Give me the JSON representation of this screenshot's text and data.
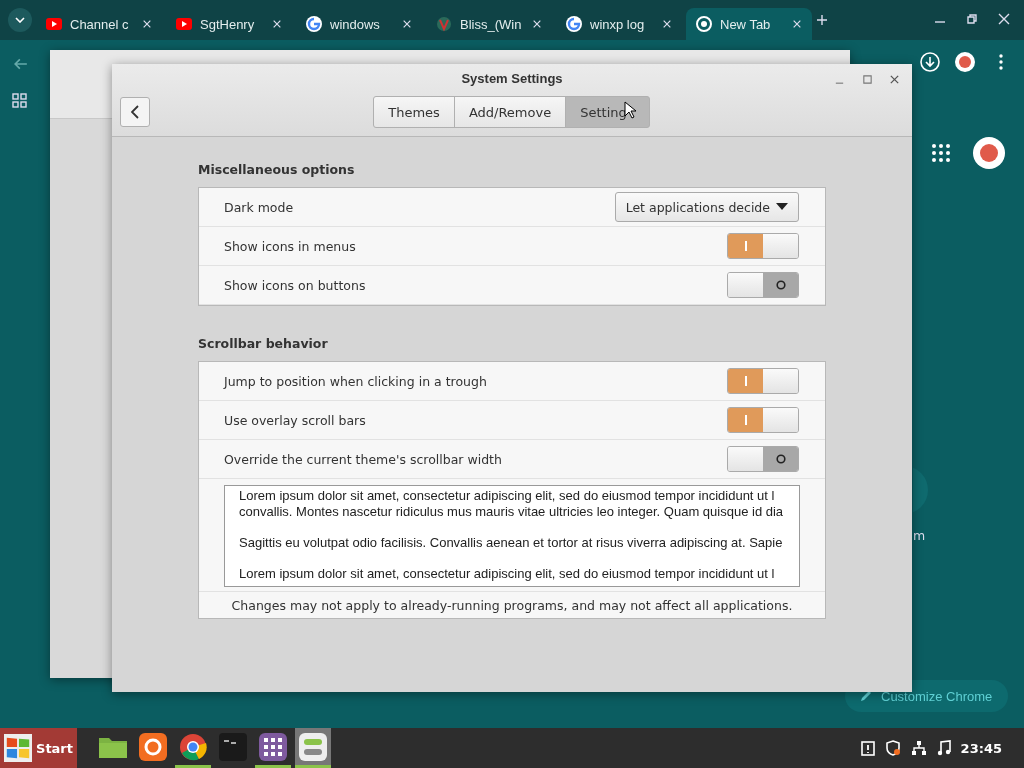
{
  "browser": {
    "tabs": [
      {
        "title": "Channel c",
        "kind": "video",
        "selected": false
      },
      {
        "title": "SgtHenry",
        "kind": "video",
        "selected": false
      },
      {
        "title": "windows",
        "kind": "search",
        "selected": false
      },
      {
        "title": "Bliss_(Win",
        "kind": "wiki",
        "selected": false
      },
      {
        "title": "winxp log",
        "kind": "search",
        "selected": false
      },
      {
        "title": "New Tab",
        "kind": "browser",
        "selected": true
      }
    ],
    "shortcut_label": "m",
    "customize_button": "Customize Chrome"
  },
  "settings_window": {
    "title": "System Settings",
    "tabs": [
      {
        "label": "Themes",
        "selected": false
      },
      {
        "label": "Add/Remove",
        "selected": false
      },
      {
        "label": "Setting",
        "selected": true
      }
    ],
    "sections": [
      {
        "heading": "Miscellaneous options",
        "rows": [
          {
            "kind": "dropdown",
            "label": "Dark mode",
            "value": "Let applications decide"
          },
          {
            "kind": "switch",
            "label": "Show icons in menus",
            "on": true
          },
          {
            "kind": "switch",
            "label": "Show icons on buttons",
            "on": false
          }
        ]
      },
      {
        "heading": "Scrollbar behavior",
        "rows": [
          {
            "kind": "switch",
            "label": "Jump to position when clicking in a trough",
            "on": true
          },
          {
            "kind": "switch",
            "label": "Use overlay scroll bars",
            "on": true
          },
          {
            "kind": "switch",
            "label": "Override the current theme's scrollbar width",
            "on": false
          }
        ],
        "text_view": {
          "paragraphs": [
            [
              "Lorem ipsum dolor sit amet, consectetur adipiscing elit, sed do eiusmod tempor incididunt ut l",
              "convallis. Montes nascetur ridiculus mus mauris vitae ultricies leo integer. Quam quisque id dia"
            ],
            [
              "Sagittis eu volutpat odio facilisis. Convallis aenean et tortor at risus viverra adipiscing at. Sapie"
            ],
            [
              "Lorem ipsum dolor sit amet, consectetur adipiscing elit, sed do eiusmod tempor incididunt ut l"
            ]
          ]
        },
        "footnote": "Changes may not apply to already-running programs, and may not affect all applications."
      }
    ]
  },
  "taskbar": {
    "start_label": "Start",
    "apps": [
      {
        "kind": "folder",
        "running": false,
        "selected": false
      },
      {
        "kind": "update",
        "running": false,
        "selected": false
      },
      {
        "kind": "browser",
        "running": true,
        "selected": false
      },
      {
        "kind": "terminal",
        "running": false,
        "selected": false
      },
      {
        "kind": "grid",
        "running": true,
        "selected": false
      },
      {
        "kind": "settings",
        "running": true,
        "selected": true
      }
    ],
    "clock": "23:45"
  }
}
